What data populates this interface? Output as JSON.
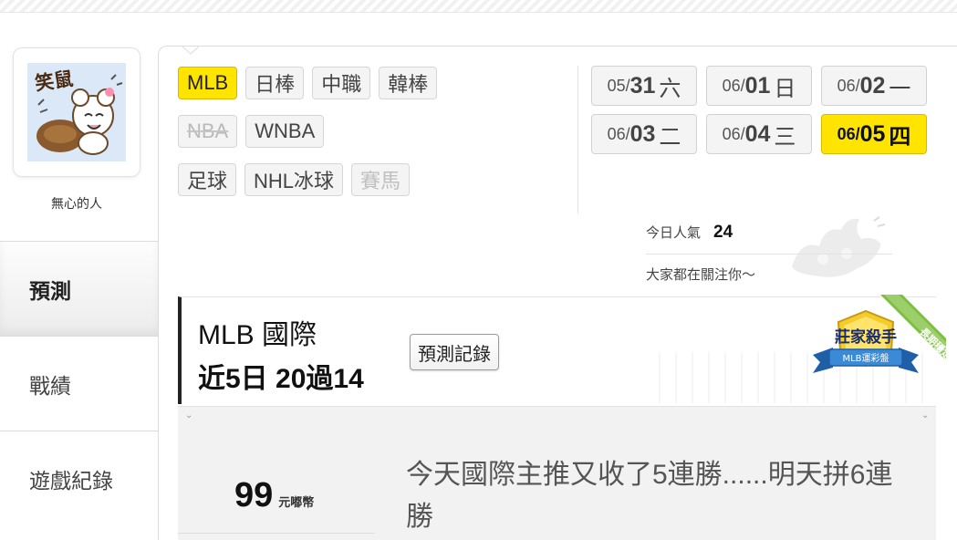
{
  "user": {
    "avatar_text": "笑鼠",
    "name": "無心的人"
  },
  "sidebar": {
    "items": [
      {
        "label": "預測"
      },
      {
        "label": "戰績"
      },
      {
        "label": "遊戲紀錄"
      }
    ]
  },
  "categories": {
    "row1": [
      "MLB",
      "日棒",
      "中職",
      "韓棒"
    ],
    "row2": [
      "NBA",
      "WNBA"
    ],
    "row3": [
      "足球",
      "NHL冰球",
      "賽馬"
    ]
  },
  "dates": [
    {
      "md": "05/",
      "dd": "31",
      "wd": "六"
    },
    {
      "md": "06/",
      "dd": "01",
      "wd": "日"
    },
    {
      "md": "06/",
      "dd": "02",
      "wd": "一"
    },
    {
      "md": "06/",
      "dd": "03",
      "wd": "二"
    },
    {
      "md": "06/",
      "dd": "04",
      "wd": "三"
    },
    {
      "md": "06/",
      "dd": "05",
      "wd": "四"
    }
  ],
  "popularity": {
    "label": "今日人氣",
    "value": "24",
    "tagline": "大家都在關注你～"
  },
  "prediction": {
    "title": "MLB 國際",
    "record": "近5日 20過14",
    "record_button": "預測記錄",
    "badge_title": "莊家殺手",
    "badge_sub": "MLB運彩盤",
    "badge_ribbon": "長期穩定",
    "coin_value": "99",
    "coin_unit": "元嘟幣",
    "message": "今天國際主推又收了5連勝......明天拼6連勝"
  },
  "colors": {
    "active_yellow": "#ffe400",
    "chip_gray": "#f4f4f4",
    "badge_blue": "#1f5fa8",
    "badge_gold": "#f4cc2b"
  }
}
